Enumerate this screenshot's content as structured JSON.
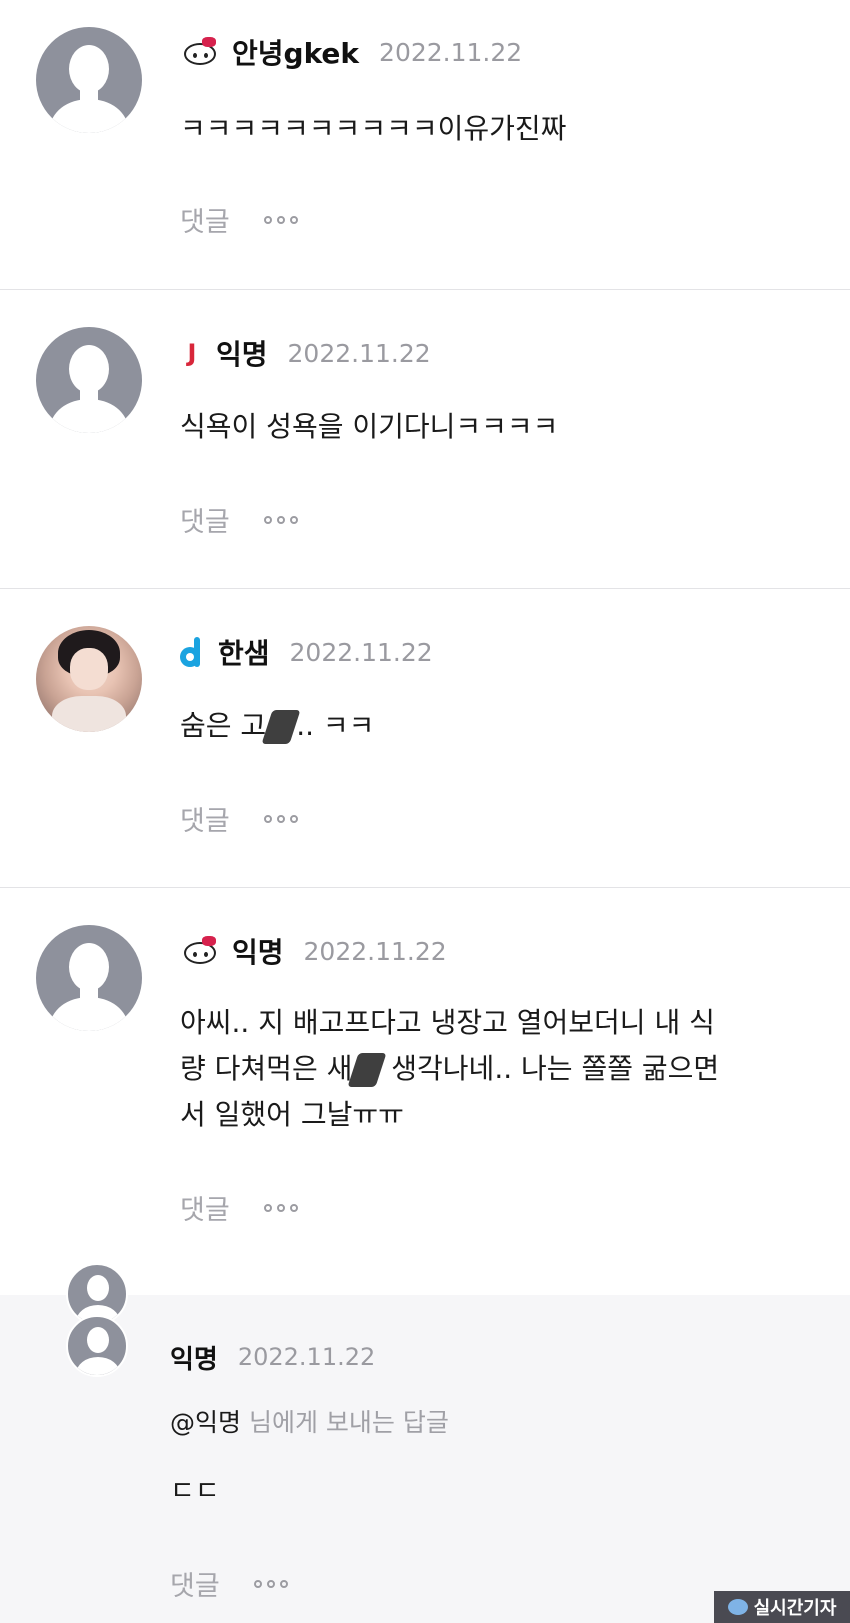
{
  "comments": [
    {
      "name": "안녕gkek",
      "date": "2022.11.22",
      "text": "ㅋㅋㅋㅋㅋㅋㅋㅋㅋㅋ이유가진짜",
      "badge": "hello-kitty-icon"
    },
    {
      "name": "익명",
      "date": "2022.11.22",
      "text": "식욕이 성욕을 이기다니ㅋㅋㅋㅋ",
      "badge": "j-badge-icon"
    },
    {
      "name": "한샘",
      "date": "2022.11.22",
      "text_before": "숨은 고",
      "text_after": ".. ㅋㅋ",
      "badge": "d-badge-icon"
    },
    {
      "name": "익명",
      "date": "2022.11.22",
      "line1": "아씨.. 지 배고프다고 냉장고 열어보더니 내 식",
      "line2_before": "량 다쳐먹은 새",
      "line2_after": " 생각나네.. 나는 쫄쫄 굶으면",
      "line3": "서 일했어 그날ㅠㅠ",
      "badge": "hello-kitty-icon"
    }
  ],
  "reply": {
    "name": "익명",
    "date": "2022.11.22",
    "mention_name": "@익명",
    "mention_suffix": " 님에게 보내는 답글",
    "text": "ㄷㄷ"
  },
  "actions": {
    "reply_label": "댓글"
  },
  "watermark": {
    "text": "실시간기자"
  },
  "colors": {
    "avatar": "#8e919c",
    "date": "#9a9aa0",
    "action": "#a6a6ac",
    "reply_bg": "#f6f6f8",
    "divider": "#e3e3e6"
  }
}
